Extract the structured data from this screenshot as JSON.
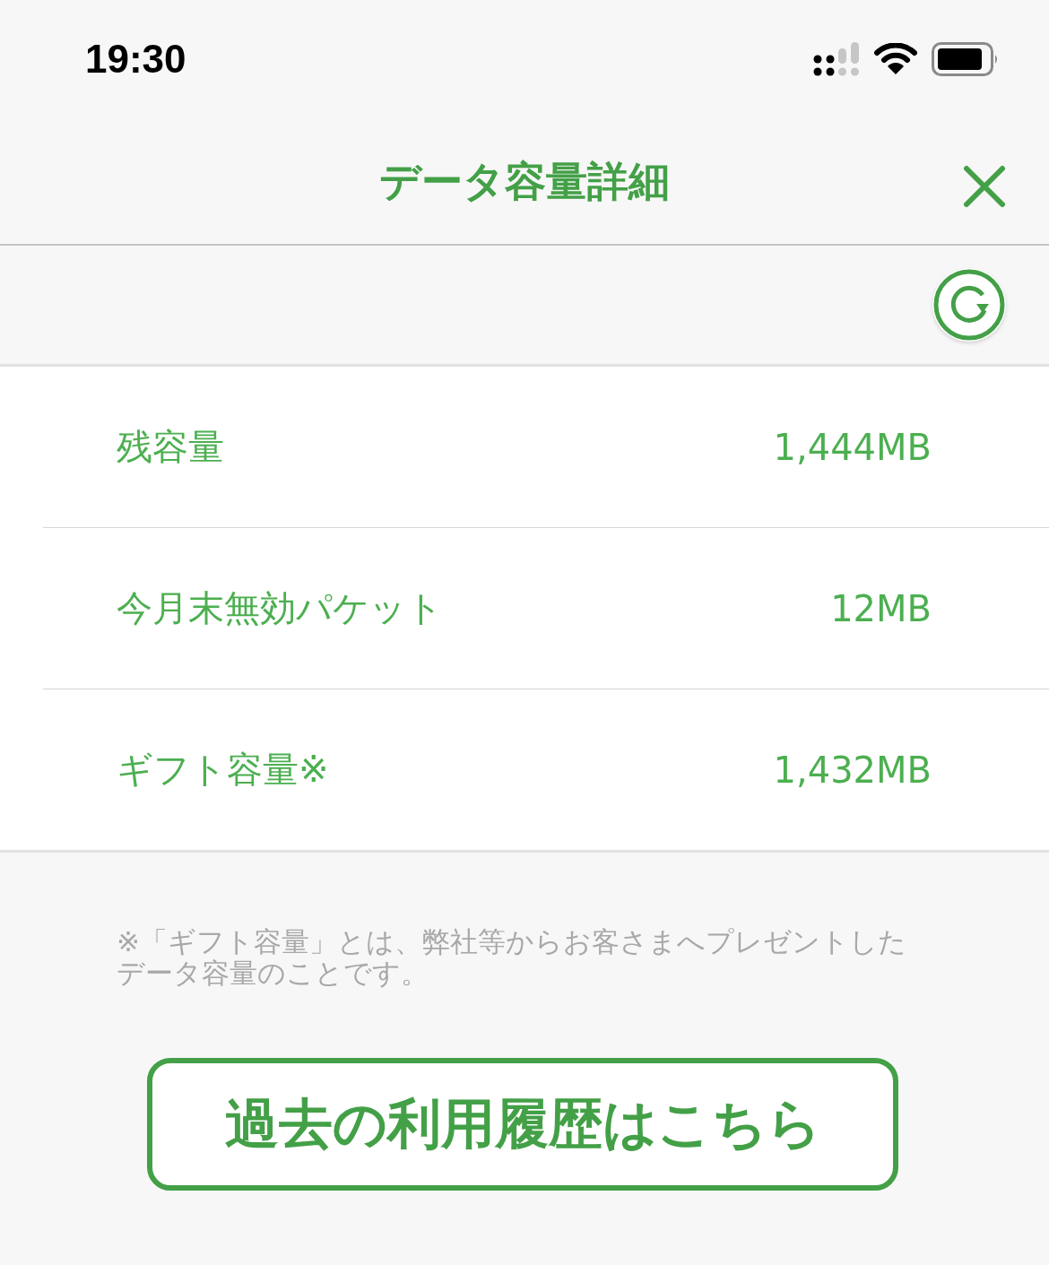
{
  "status_bar": {
    "time": "19:30"
  },
  "header": {
    "title": "データ容量詳細"
  },
  "rows": [
    {
      "label": "残容量",
      "value": "1,444MB"
    },
    {
      "label": "今月末無効パケット",
      "value": "12MB"
    },
    {
      "label": "ギフト容量※",
      "value": "1,432MB"
    }
  ],
  "note": "※「ギフト容量」とは、弊社等からお客さまへプレゼントしたデータ容量のことです。",
  "history_button": "過去の利用履歴はこちら"
}
